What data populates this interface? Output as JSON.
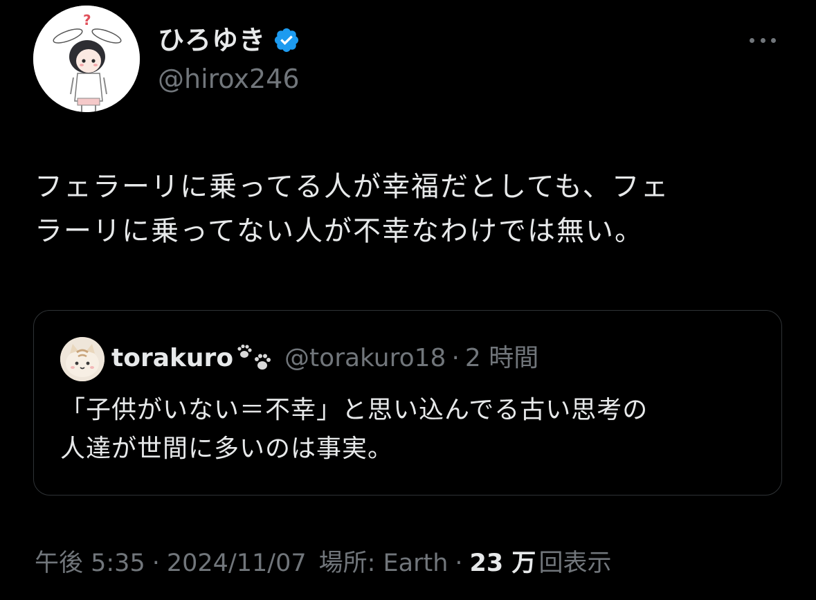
{
  "author": {
    "display_name": "ひろゆき",
    "handle": "@hirox246",
    "avatar_icon": "bunny-character-avatar",
    "verified_icon": "verified-badge-icon",
    "verified_color": "#1d9bf0"
  },
  "more_icon": "more-options-icon",
  "tweet": {
    "lines": [
      "フェラーリに乗ってる人が幸福だとしても、フェ",
      "ラーリに乗ってない人が不幸なわけでは無い。"
    ]
  },
  "quote": {
    "display_name": "torakuro",
    "name_emoji_icon": "paw-prints-icon",
    "handle": "@torakuro18",
    "separator": "·",
    "time": "2 時間",
    "avatar_icon": "cat-face-avatar",
    "lines": [
      "「子供がいない＝不幸」と思い込んでる古い思考の",
      "人達が世間に多いのは事実。"
    ]
  },
  "meta": {
    "time": "午後 5:35",
    "separator": "·",
    "date": "2024/11/07",
    "location": "場所: Earth",
    "views_count": "23 万",
    "views_label": "回表示"
  },
  "colors": {
    "background": "#000000",
    "text": "#e7e9ea",
    "secondary": "#71767b",
    "border": "#2f3336"
  }
}
